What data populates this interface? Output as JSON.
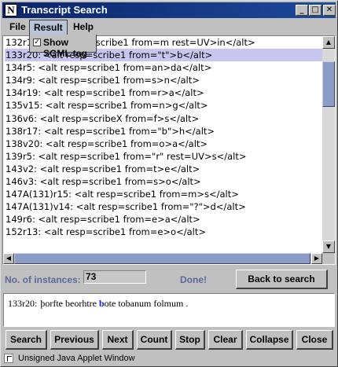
{
  "window": {
    "title": "Transcript Search",
    "app_icon_letter": "N"
  },
  "titlebar_buttons": {
    "minimize": "_",
    "maximize": "□",
    "close": "✕"
  },
  "menu": {
    "file": "File",
    "result": "Result",
    "help": "Help"
  },
  "dropdown": {
    "check_mark": "✓",
    "show_sgml_label": "Show SGML tag",
    "checked": true
  },
  "list": {
    "rows": [
      "132r1 ... <alt resp=scribe1 from=m rest=UV>in</alt>",
      "133r20: <alt resp=scribe1 from=\"t\">b</alt>",
      "134r5: <alt resp=scribe1 from=an>da</alt>",
      "134r9: <alt resp=scribe1 from=s>n</alt>",
      "134r19: <alt resp=scribe1 from=r>a</alt>",
      "135v15: <alt resp=scribe1 from=n>g</alt>",
      "136v6: <alt resp=scribeX from=f>s</alt>",
      "138r17: <alt resp=scribe1 from=\"b\">h</alt>",
      "138v20: <alt resp=scribe1 from=o>a</alt>",
      "139r5: <alt resp=scribe1 from=\"r\" rest=UV>s</alt>",
      "143v2: <alt resp=scribe1 from=t>e</alt>",
      "146v3: <alt resp=scribe1 from=s>o</alt>",
      "147A(131)r15: <alt resp=scribe1 from=m>s</alt>",
      "147A(131)v14: <alt resp=scribe1 from=\"?\">d</alt>",
      "149r6: <alt resp=scribe1 from=e>a</alt>",
      "152r13: <alt resp=scribe1 from=e>o</alt>"
    ],
    "selected_index": 1,
    "row_first_visible_prefix": "132r1",
    "row_first_visible_suffix": "m=m rest=UV>in</alt>"
  },
  "scroll_glyphs": {
    "up": "▲",
    "down": "▼",
    "left": "◀",
    "right": "▶"
  },
  "status": {
    "instances_label": "No. of instances:",
    "instances_value": "73",
    "done_label": "Done!",
    "back_button": "Back to search"
  },
  "result": {
    "ref": "133r20:",
    "text_before": "þorfte beorhtre ",
    "highlight": "b",
    "text_after": "ote tobanum folmum ."
  },
  "buttons": {
    "search": "Search",
    "previous": "Previous",
    "next": "Next",
    "count": "Count",
    "stop": "Stop",
    "clear": "Clear",
    "collapse": "Collapse",
    "close": "Close"
  },
  "statusbar": {
    "text": "Unsigned Java Applet Window"
  },
  "colors": {
    "title_bar": "#0a246a",
    "selected_row": "#c6c6ef",
    "highlight": "#1a1aff",
    "label": "#5a6a9a",
    "thumb": "#8c9cc8"
  }
}
